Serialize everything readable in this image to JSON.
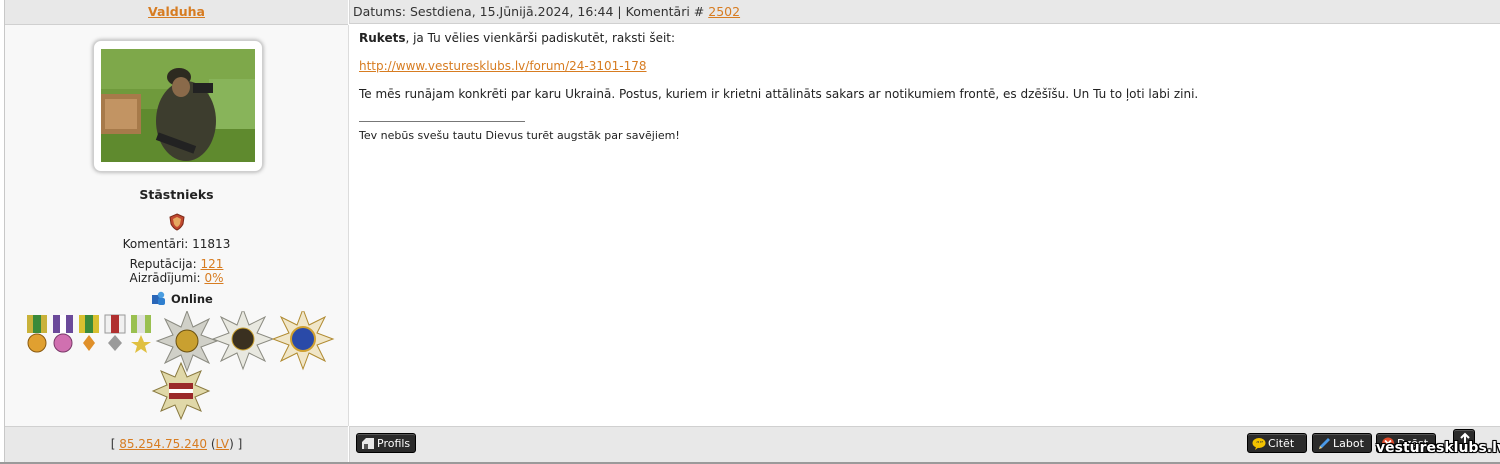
{
  "post": {
    "author": "Valduha",
    "date_label": "Datums:",
    "date_value": "Sestdiena, 15.Jūnijā.2024, 16:44",
    "separator": "|",
    "comment_label": "Komentāri #",
    "comment_number": "2502"
  },
  "profile": {
    "rank": "Stāstnieks",
    "comments_label": "Komentāri:",
    "comments_value": "11813",
    "reputation_label": "Reputācija:",
    "reputation_value": "121",
    "warnings_label": "Aizrādījumi:",
    "warnings_value": "0%",
    "status": "Online"
  },
  "body": {
    "quoted_name": "Rukets",
    "line1_rest": ", ja Tu vēlies vienkārši padiskutēt, raksti šeit:",
    "link": "http://www.vesturesklubs.lv/forum/24-3101-178",
    "line3": "Te mēs runājam konkrēti par karu Ukrainā. Postus, kuriem ir krietni attālināts sakars ar notikumiem frontē, es dzēšīšu. Un Tu to ļoti labi zini.",
    "signature": "Tev nebūs svešu tautu Dievus turēt augstāk par savējiem!"
  },
  "footer": {
    "ip": "85.254.75.240",
    "country": "LV",
    "bracket_open": "[",
    "bracket_close": "]",
    "paren_open": "(",
    "paren_close": ")",
    "profile_button": "Profils",
    "quote_button": "Citēt",
    "edit_button": "Labot",
    "delete_button": "Dzēst"
  },
  "watermark": "vesturesklubs.lv",
  "colors": {
    "link": "#d77c21",
    "header_bg": "#e8e8e8",
    "button_bg": "#2b2b2b"
  },
  "icons": [
    "rank-shield-icon",
    "online-user-icon",
    "profile-icon",
    "quote-bubble-icon",
    "pencil-icon",
    "delete-icon",
    "scroll-top-icon"
  ]
}
